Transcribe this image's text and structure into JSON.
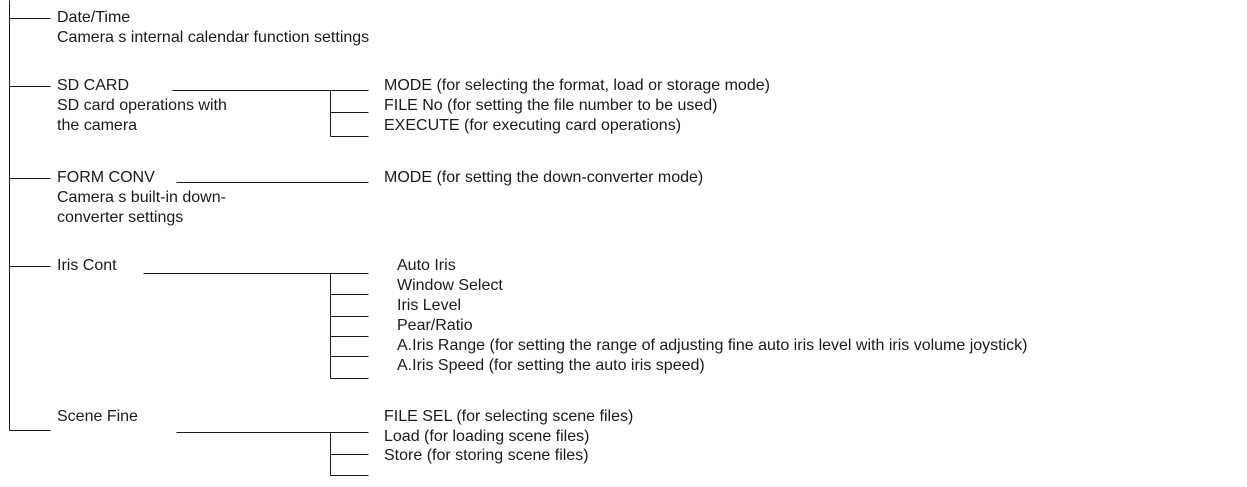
{
  "nodes": [
    {
      "title": "Date/Time",
      "description": [
        "Camera s internal calendar function settings"
      ],
      "items": []
    },
    {
      "title": "SD CARD",
      "description": [
        "SD card operations with",
        "the camera"
      ],
      "items": [
        "MODE (for selecting the format, load or storage mode)",
        "FILE No (for setting the file number to be used)",
        "EXECUTE (for executing card operations)"
      ]
    },
    {
      "title": "FORM CONV",
      "description": [
        "Camera s built-in down-",
        "converter settings"
      ],
      "items": [
        "MODE (for setting the down-converter mode)"
      ]
    },
    {
      "title": "Iris Cont",
      "description": [],
      "items": [
        "Auto Iris",
        "Window Select",
        "Iris Level",
        "Pear/Ratio",
        "A.Iris Range (for setting the range of adjusting fine auto iris level with iris volume joystick)",
        "A.Iris Speed (for setting the auto iris speed)"
      ]
    },
    {
      "title": "Scene Fine",
      "description": [],
      "items": [
        "FILE SEL (for selecting scene files)",
        "Load (for loading scene files)",
        "Store (for storing scene files)"
      ]
    }
  ]
}
